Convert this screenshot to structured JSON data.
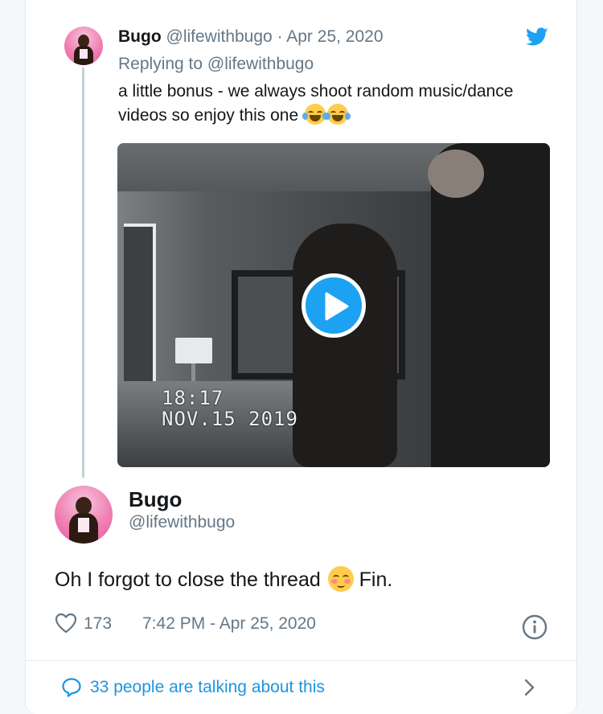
{
  "quoted_tweet": {
    "display_name": "Bugo",
    "handle": "@lifewithbugo",
    "separator": " · ",
    "date": "Apr 25, 2020",
    "replying_to": "Replying to @lifewithbugo",
    "text": "a little bonus - we always shoot random music/dance videos so enjoy this one",
    "emojis": [
      "face-with-tears-of-joy",
      "face-with-tears-of-joy"
    ],
    "video": {
      "overlay_time": "18:17",
      "overlay_date": "NOV.15 2019"
    }
  },
  "main_tweet": {
    "display_name": "Bugo",
    "handle": "@lifewithbugo",
    "text_before": "Oh I forgot to close the thread",
    "emoji": "smiling-face-with-blush",
    "text_after": "Fin.",
    "like_count": "173",
    "timestamp": "7:42 PM - Apr 25, 2020"
  },
  "footer": {
    "conversation_label": "33 people are talking about this"
  },
  "colors": {
    "accent": "#1da1f2",
    "link": "#1b95e0",
    "muted": "#657786",
    "avatar_bg": "#ef7fb3"
  },
  "icons": [
    "twitter-bird-icon",
    "play-icon",
    "heart-icon",
    "info-icon",
    "speech-bubble-icon",
    "chevron-right-icon"
  ]
}
